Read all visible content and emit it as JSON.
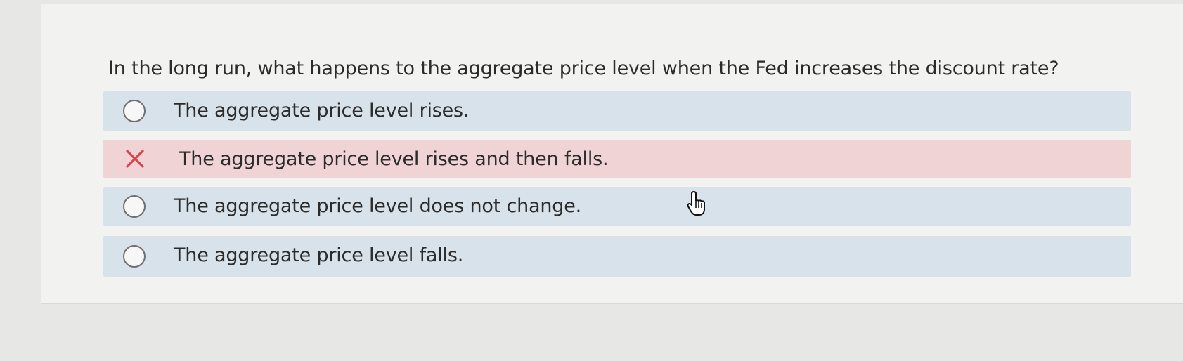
{
  "question": {
    "text": "In the long run, what happens to the aggregate price level when the Fed increases the discount rate?"
  },
  "options": [
    {
      "label": "The aggregate price level rises.",
      "state": "unselected",
      "indicator": "radio-icon"
    },
    {
      "label": "The aggregate price level rises and then falls.",
      "state": "incorrect",
      "indicator": "x-mark-icon"
    },
    {
      "label": "The aggregate price level does not change.",
      "state": "unselected",
      "indicator": "radio-icon"
    },
    {
      "label": "The aggregate price level falls.",
      "state": "unselected",
      "indicator": "radio-icon"
    }
  ],
  "colors": {
    "option_background": "#d7e2ea",
    "incorrect_background": "#f0d3d5",
    "incorrect_mark": "#d9434b",
    "text": "#2b2b2b"
  },
  "cursor": {
    "icon": "hand-pointer-icon"
  }
}
